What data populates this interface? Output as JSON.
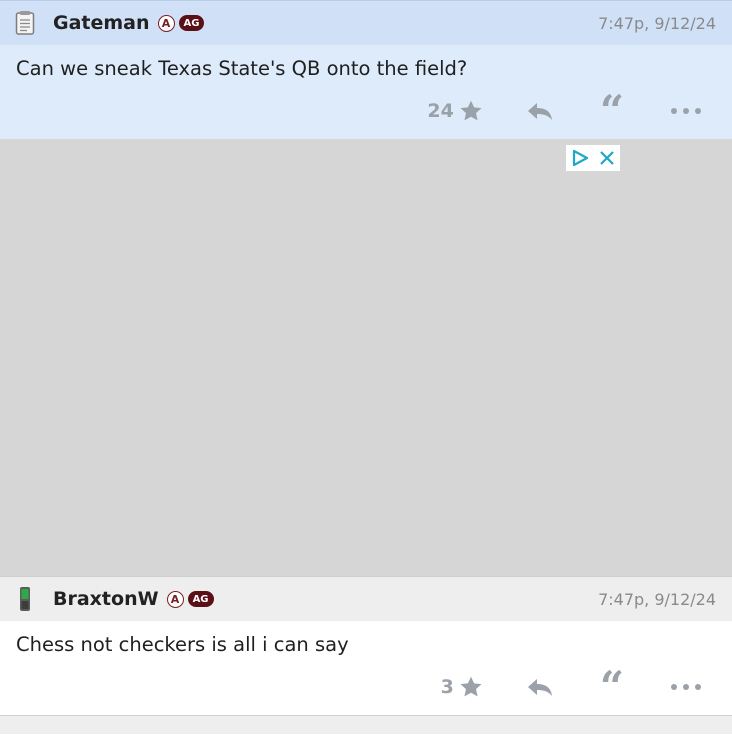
{
  "posts": [
    {
      "username": "Gateman",
      "badge_a": "A",
      "badge_ag": "AG",
      "timestamp": "7:47p, 9/12/24",
      "text": "Can we sneak Texas State's QB onto the field?",
      "likes": "24",
      "device_icon": "notepad-icon"
    },
    {
      "username": "BraxtonW",
      "badge_a": "A",
      "badge_ag": "AG",
      "timestamp": "7:47p, 9/12/24",
      "text": "Chess not checkers is all i can say",
      "likes": "3",
      "device_icon": "phone-icon"
    }
  ],
  "colors": {
    "highlight_header": "#d0e1f7",
    "highlight_body": "#deebfb",
    "ad_background": "#d6d6d6",
    "badge_maroon": "#5b1018",
    "icon_gray": "#9aa1a8",
    "adchoices_teal": "#1fa7c7"
  }
}
